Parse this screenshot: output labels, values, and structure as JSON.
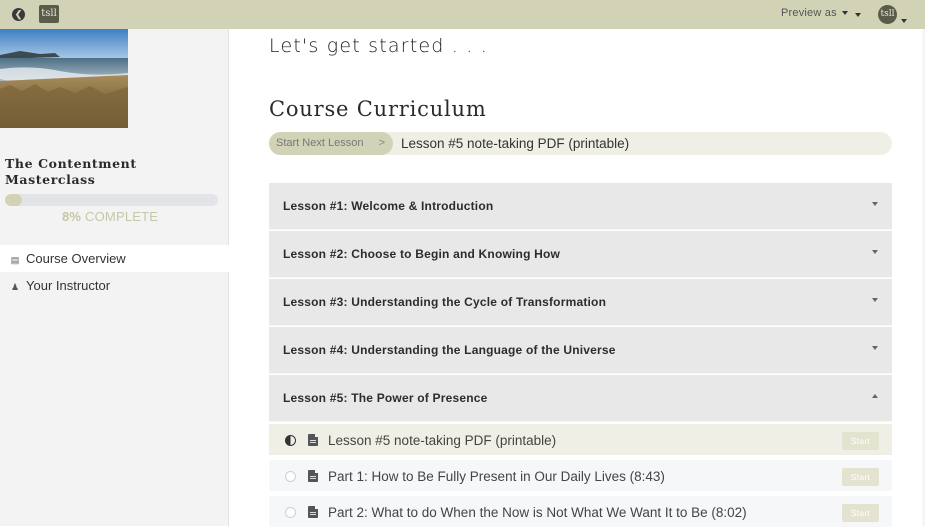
{
  "topbar": {
    "logo_text": "tsll",
    "preview_label": "Preview as",
    "avatar_text": "tsll"
  },
  "sidebar": {
    "course_title": "The Contentment Masterclass",
    "progress": {
      "percent_value": 8,
      "percent_text": "8%",
      "complete_text": "COMPLETE"
    },
    "nav": [
      {
        "label": "Course Overview",
        "icon": "book-icon",
        "active": true
      },
      {
        "label": "Your Instructor",
        "icon": "user-icon",
        "active": false
      }
    ]
  },
  "main": {
    "welcome": "Let's get started . . .",
    "curriculum_title": "Course Curriculum",
    "start_next": {
      "button_label": "Start Next Lesson",
      "chevron": ">",
      "lesson": "Lesson #5 note-taking PDF (printable)"
    },
    "sections": [
      {
        "title": "Lesson #1: Welcome & Introduction",
        "expanded": false
      },
      {
        "title": "Lesson #2: Choose to Begin and Knowing How",
        "expanded": false
      },
      {
        "title": "Lesson #3: Understanding the Cycle of Transformation",
        "expanded": false
      },
      {
        "title": "Lesson #4: Understanding the Language of the Universe",
        "expanded": false
      },
      {
        "title": "Lesson #5: The Power of Presence",
        "expanded": true
      }
    ],
    "lectures": [
      {
        "title": "Lesson #5 note-taking PDF (printable)",
        "status": "in-progress",
        "button": "Start"
      },
      {
        "title": "Part 1: How to Be Fully Present in Our Daily Lives (8:43)",
        "status": "not-started",
        "button": "Start"
      },
      {
        "title": "Part 2: What to do When the Now is Not What We Want It to Be (8:02)",
        "status": "not-started",
        "button": "Start"
      }
    ]
  },
  "colors": {
    "accent": "#d2d3b6",
    "section_bg": "#e8e8e8",
    "sidebar_bg": "#f3f3f3"
  }
}
